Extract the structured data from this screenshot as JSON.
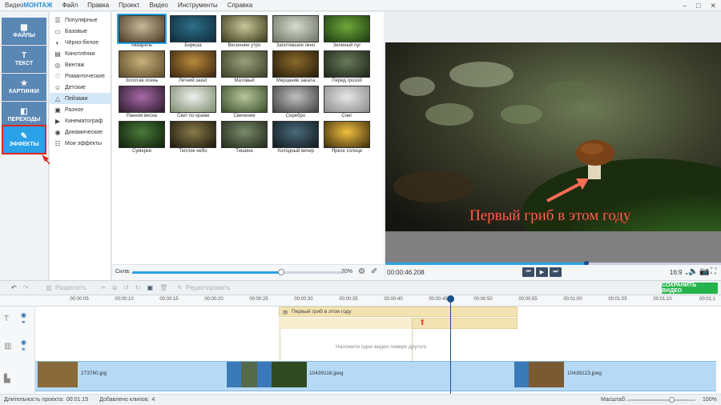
{
  "app": {
    "title_prefix": "Видео",
    "title_brand": "МОНТАЖ"
  },
  "menu": [
    "Файл",
    "Правка",
    "Проект",
    "Видео",
    "Инструменты",
    "Справка"
  ],
  "window_controls": [
    "–",
    "□",
    "✕"
  ],
  "sidebar": [
    {
      "label": "ФАЙЛЫ",
      "icon": "files-icon",
      "glyph": "▦"
    },
    {
      "label": "ТЕКСТ",
      "icon": "text-icon",
      "glyph": "T"
    },
    {
      "label": "КАРТИНКИ",
      "icon": "star-icon",
      "glyph": "★"
    },
    {
      "label": "ПЕРЕХОДЫ",
      "icon": "transitions-icon",
      "glyph": "◧"
    },
    {
      "label": "ЭФФЕКТЫ",
      "icon": "effects-wand-icon",
      "glyph": "✎"
    }
  ],
  "categories": [
    {
      "label": "Популярные",
      "glyph": "☰"
    },
    {
      "label": "Базовые",
      "glyph": "▭"
    },
    {
      "label": "Чёрно-белое",
      "glyph": "◐"
    },
    {
      "label": "Кинотлёнки",
      "glyph": "▤"
    },
    {
      "label": "Винтаж",
      "glyph": "◎"
    },
    {
      "label": "Романтические",
      "glyph": "♡"
    },
    {
      "label": "Детские",
      "glyph": "☺"
    },
    {
      "label": "Пейзажи",
      "glyph": "△"
    },
    {
      "label": "Разное",
      "glyph": "▣"
    },
    {
      "label": "Кинематограф",
      "glyph": "▶"
    },
    {
      "label": "Динамические",
      "glyph": "◉"
    },
    {
      "label": "Мои эффекты",
      "glyph": "☷"
    }
  ],
  "effects": [
    {
      "label": "Акварель",
      "c1": "#c7b89a",
      "c2": "#4a3a22"
    },
    {
      "label": "Бирюза",
      "c1": "#2f6f8a",
      "c2": "#0d2a38"
    },
    {
      "label": "Весеннее утро",
      "c1": "#c9c79a",
      "c2": "#3a3a1a"
    },
    {
      "label": "Запотевшее окно",
      "c1": "#d8dcd0",
      "c2": "#6c7262"
    },
    {
      "label": "Зеленый луг",
      "c1": "#6fa83a",
      "c2": "#1b3a0f"
    },
    {
      "label": "Золотая осень",
      "c1": "#c9b17a",
      "c2": "#5a4a2a"
    },
    {
      "label": "Летний закат",
      "c1": "#b88a3a",
      "c2": "#3a2410"
    },
    {
      "label": "Матовый",
      "c1": "#9aa07a",
      "c2": "#3a3e28"
    },
    {
      "label": "Мерцание заката",
      "c1": "#8a6a2a",
      "c2": "#241a08"
    },
    {
      "label": "Перед грозой",
      "c1": "#6a7a5a",
      "c2": "#1a2418"
    },
    {
      "label": "Ранняя весна",
      "c1": "#a86aa8",
      "c2": "#2a1a2a"
    },
    {
      "label": "Свет по краям",
      "c1": "#f0f0f0",
      "c2": "#7a8a6a"
    },
    {
      "label": "Свечение",
      "c1": "#b8c89a",
      "c2": "#3a4a2a"
    },
    {
      "label": "Серебро",
      "c1": "#c0c0c0",
      "c2": "#404040"
    },
    {
      "label": "Снег",
      "c1": "#e6e6e6",
      "c2": "#8a8a8a"
    },
    {
      "label": "Сумерки",
      "c1": "#4a7a3a",
      "c2": "#0f1f0a"
    },
    {
      "label": "Теплое небо",
      "c1": "#8a7a4a",
      "c2": "#1a160a"
    },
    {
      "label": "Тишина",
      "c1": "#7a8a6a",
      "c2": "#22281a"
    },
    {
      "label": "Холодный вечер",
      "c1": "#4a6a7a",
      "c2": "#0f1a20"
    },
    {
      "label": "Яркое солнце",
      "c1": "#f0c040",
      "c2": "#3a2a0a"
    }
  ],
  "strength": {
    "label": "Сила:",
    "value_label": "70%",
    "value": 0.7
  },
  "preview": {
    "caption": "Первый гриб в этом году",
    "time": "00:00:46.208",
    "aspect": "16:9",
    "progress": 0.6
  },
  "toolbar": {
    "split": "Разделить",
    "edit": "Редактировать",
    "save": "СОХРАНИТЬ ВИДЕО"
  },
  "ruler_ticks": [
    "00:00:05",
    "00:00:10",
    "00:00:15",
    "00:00:20",
    "00:00:25",
    "00:00:30",
    "00:00:35",
    "00:00:40",
    "00:00:45",
    "00:00:50",
    "00:00:55",
    "00:01:00",
    "00:01:05",
    "00:01:10",
    "00:01:1"
  ],
  "timeline": {
    "text_clip": "Первый гриб в этом году",
    "overlay_hint": "Наложите одно видео поверх другого",
    "clips": [
      "273760.jpg",
      "10439116.jpeg",
      "10439123.jpeg"
    ]
  },
  "status": {
    "duration_label": "Длительность проекта:",
    "duration": "00:01:15",
    "clips_label": "Добавлено клипов:",
    "clips": "4",
    "zoom_label": "Масштаб:",
    "zoom": "100%"
  }
}
